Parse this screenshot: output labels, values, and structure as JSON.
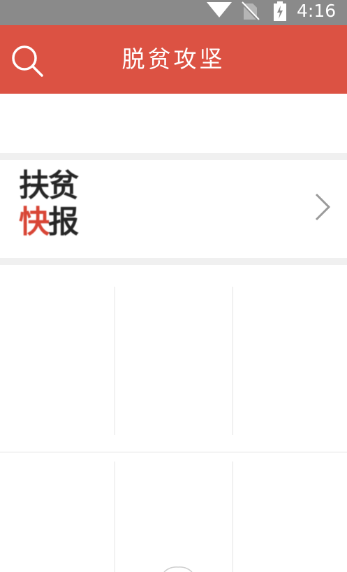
{
  "status_bar": {
    "time": "4:16",
    "icons": [
      "wifi-icon",
      "no-sim-icon",
      "battery-charging-icon"
    ]
  },
  "app_bar": {
    "title": "脱贫攻坚",
    "search_icon": "search-icon"
  },
  "news_banner": {
    "logo_line1_char1": "扶",
    "logo_line1_char2": "贫",
    "logo_line2_char1": "快",
    "logo_line2_char2": "报",
    "chevron_icon": "chevron-right-icon"
  },
  "grid": {
    "rows": 2,
    "columns": 3,
    "cells": [
      {
        "label": ""
      },
      {
        "label": ""
      },
      {
        "label": ""
      },
      {
        "label": ""
      },
      {
        "label": ""
      },
      {
        "label": ""
      }
    ]
  },
  "colors": {
    "app_bar": "#dc5243",
    "status_bar": "#8a8a8a",
    "logo_accent": "#d84535",
    "logo_dark": "#262626",
    "divider": "#f0f0f0"
  }
}
